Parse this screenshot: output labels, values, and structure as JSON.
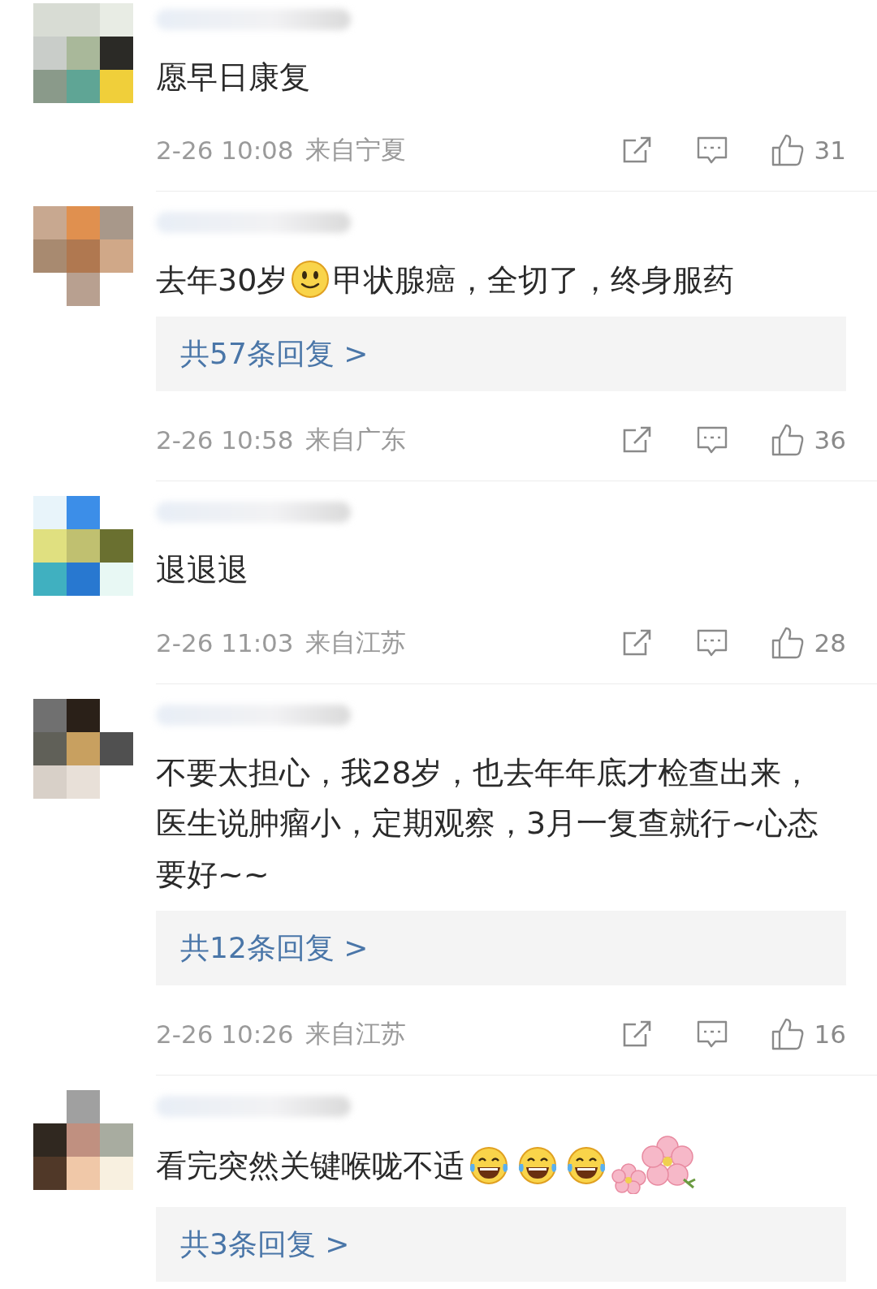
{
  "comments": [
    {
      "segments": [
        {
          "kind": "text",
          "text": "愿早日康复"
        }
      ],
      "time": "2-26 10:08",
      "location": "来自宁夏",
      "likes": "31"
    },
    {
      "segments": [
        {
          "kind": "text",
          "text": "去年30岁"
        },
        {
          "kind": "smile-emoji"
        },
        {
          "kind": "text",
          "text": "甲状腺癌，全切了，终身服药"
        }
      ],
      "replies": "共57条回复 >",
      "time": "2-26 10:58",
      "location": "来自广东",
      "likes": "36"
    },
    {
      "segments": [
        {
          "kind": "text",
          "text": "退退退"
        }
      ],
      "time": "2-26 11:03",
      "location": "来自江苏",
      "likes": "28"
    },
    {
      "segments": [
        {
          "kind": "text",
          "text": "不要太担心，我28岁，也去年年底才检查出来，医生说肿瘤小，定期观察，3月一复查就行~心态要好~~"
        }
      ],
      "replies": "共12条回复 >",
      "time": "2-26 10:26",
      "location": "来自江苏",
      "likes": "16"
    },
    {
      "segments": [
        {
          "kind": "text",
          "text": "看完突然关键喉咙不适"
        },
        {
          "kind": "laugh-emoji"
        },
        {
          "kind": "laugh-emoji"
        },
        {
          "kind": "laugh-emoji"
        },
        {
          "kind": "flower-sticker"
        }
      ],
      "replies": "共3条回复 >"
    }
  ]
}
